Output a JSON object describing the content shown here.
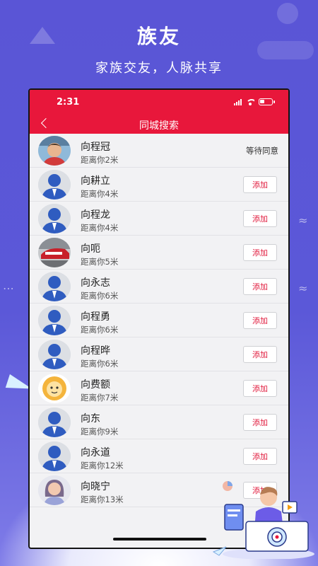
{
  "promo": {
    "headline": "族友",
    "subline": "家族交友，人脉共享"
  },
  "status_bar": {
    "time": "2:31"
  },
  "nav": {
    "title": "同城搜索"
  },
  "colors": {
    "accent": "#e8173b",
    "background": "#5a55d6"
  },
  "users": [
    {
      "name": "向程冠",
      "distance": "距离你2米",
      "avatar": "photo-child",
      "status": "等待同意"
    },
    {
      "name": "向耕立",
      "distance": "距离你4米",
      "avatar": "default-person",
      "action": "添加"
    },
    {
      "name": "向程龙",
      "distance": "距离你4米",
      "avatar": "default-person",
      "action": "添加"
    },
    {
      "name": "向呃",
      "distance": "距离你5米",
      "avatar": "photo-train",
      "action": "添加"
    },
    {
      "name": "向永志",
      "distance": "距离你6米",
      "avatar": "default-person",
      "action": "添加"
    },
    {
      "name": "向程勇",
      "distance": "距离你6米",
      "avatar": "default-person",
      "action": "添加"
    },
    {
      "name": "向程晔",
      "distance": "距离你6米",
      "avatar": "default-person",
      "action": "添加"
    },
    {
      "name": "向费额",
      "distance": "距离你7米",
      "avatar": "cartoon-lion",
      "action": "添加"
    },
    {
      "name": "向东",
      "distance": "距离你9米",
      "avatar": "default-person",
      "action": "添加"
    },
    {
      "name": "向永道",
      "distance": "距离你12米",
      "avatar": "default-person",
      "action": "添加"
    },
    {
      "name": "向晓宁",
      "distance": "距离你13米",
      "avatar": "cartoon-woman",
      "action": "添加"
    }
  ]
}
